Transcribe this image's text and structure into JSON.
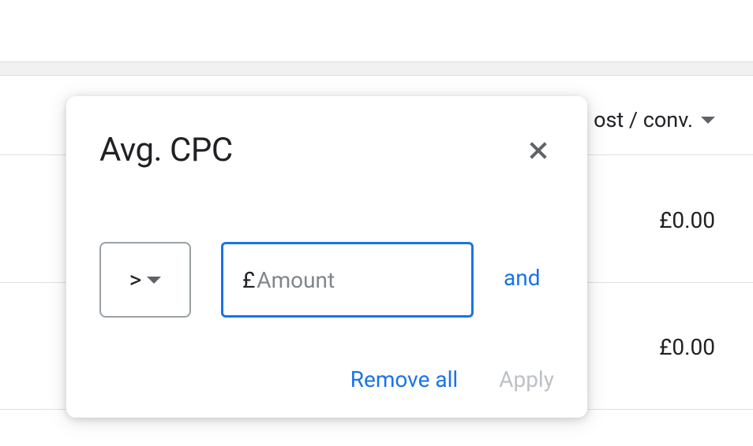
{
  "table": {
    "column_header": "ost / conv.",
    "row1_value": "£0.00",
    "row2_value": "£0.00"
  },
  "popover": {
    "title": "Avg. CPC",
    "operator_value": ">",
    "currency_symbol": "£",
    "amount_placeholder": "Amount",
    "amount_value": "",
    "and_label": "and",
    "remove_all_label": "Remove all",
    "apply_label": "Apply"
  }
}
